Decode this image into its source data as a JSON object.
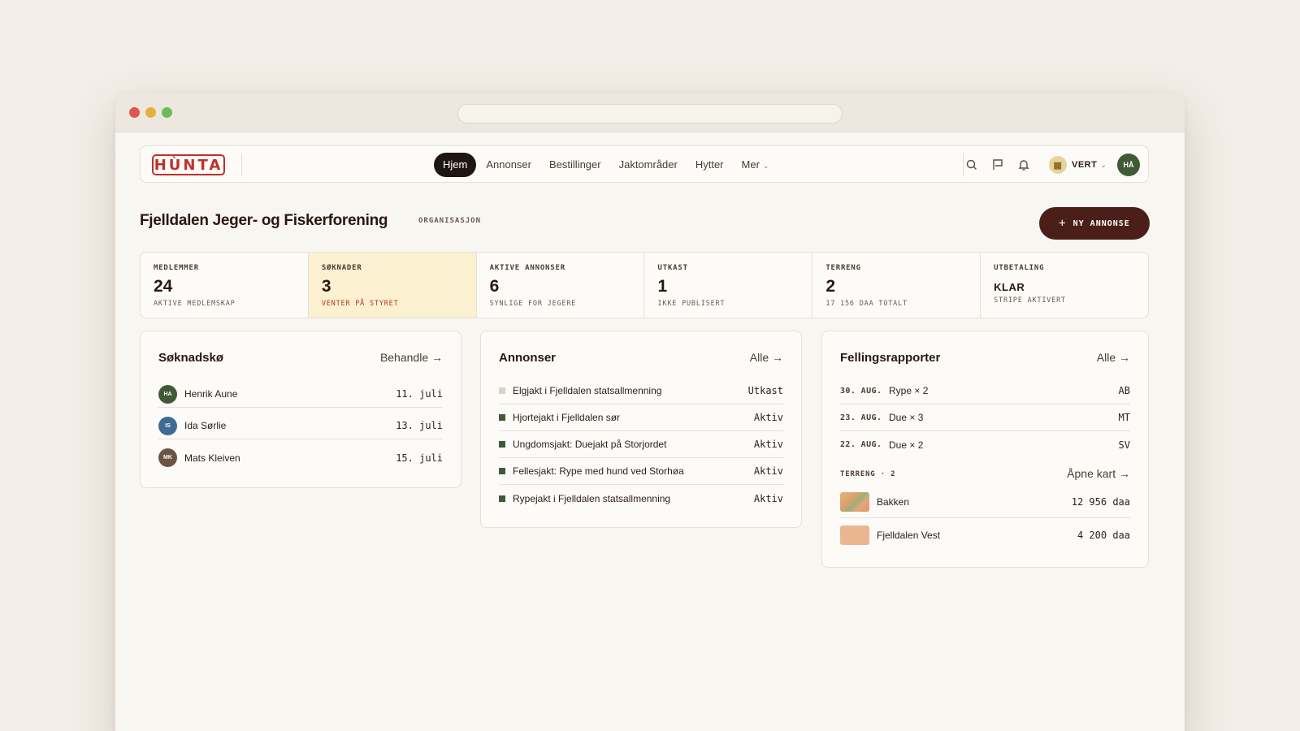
{
  "nav": {
    "logo": "HÙNTA",
    "items": [
      {
        "label": "Hjem",
        "active": true
      },
      {
        "label": "Annonser",
        "active": false
      },
      {
        "label": "Bestillinger",
        "active": false
      },
      {
        "label": "Jaktområder",
        "active": false
      },
      {
        "label": "Hytter",
        "active": false
      },
      {
        "label": "Mer",
        "active": false,
        "dropdown": true
      }
    ],
    "icons": [
      "search-icon",
      "flag-icon",
      "bell-icon"
    ],
    "host_label": "VERT",
    "avatar_initials": "HÅ"
  },
  "header": {
    "title": "Fjelldalen Jeger- og Fiskerforening",
    "tag": "ORGANISASJON",
    "new_button": "NY ANNONSE"
  },
  "stats": [
    {
      "label": "MEDLEMMER",
      "value": "24",
      "sub": "AKTIVE MEDLEMSKAP",
      "highlight": false
    },
    {
      "label": "SØKNADER",
      "value": "3",
      "sub": "VENTER PÅ STYRET",
      "highlight": true
    },
    {
      "label": "AKTIVE ANNONSER",
      "value": "6",
      "sub": "SYNLIGE FOR JEGERE",
      "highlight": false
    },
    {
      "label": "UTKAST",
      "value": "1",
      "sub": "IKKE PUBLISERT",
      "highlight": false
    },
    {
      "label": "TERRENG",
      "value": "2",
      "sub": "17 156 DAA TOTALT",
      "highlight": false
    },
    {
      "label": "UTBETALING",
      "value": "KLAR",
      "sub": "STRIPE AKTIVERT",
      "highlight": false
    }
  ],
  "queue": {
    "title": "Søknadskø",
    "link": "Behandle →",
    "rows": [
      {
        "initials": "HA",
        "name": "Henrik Aune",
        "date": "11. juli",
        "color": "#3f5a34"
      },
      {
        "initials": "IS",
        "name": "Ida Sørlie",
        "date": "13. juli",
        "color": "#3e6a93"
      },
      {
        "initials": "MK",
        "name": "Mats Kleiven",
        "date": "15. juli",
        "color": "#6b5444"
      }
    ]
  },
  "listings": {
    "title": "Annonser",
    "link": "Alle →",
    "rows": [
      {
        "name": "Elgjakt i Fjelldalen statsallmenning",
        "status": "Utkast",
        "draft": true
      },
      {
        "name": "Hjortejakt i Fjelldalen sør",
        "status": "Aktiv",
        "draft": false
      },
      {
        "name": "Ungdomsjakt: Duejakt på Storjordet",
        "status": "Aktiv",
        "draft": false
      },
      {
        "name": "Fellesjakt: Rype med hund ved Storhøa",
        "status": "Aktiv",
        "draft": false
      },
      {
        "name": "Rypejakt i Fjelldalen statsallmenning",
        "status": "Aktiv",
        "draft": false
      }
    ]
  },
  "reports": {
    "title": "Fellingsrapporter",
    "link": "Alle →",
    "rows": [
      {
        "date": "30. AUG.",
        "catch": "Rype × 2",
        "who": "AB"
      },
      {
        "date": "23. AUG.",
        "catch": "Due × 3",
        "who": "MT"
      },
      {
        "date": "22. AUG.",
        "catch": "Due × 2",
        "who": "SV"
      }
    ],
    "terrain_label": "TERRENG · 2",
    "terrain_link": "Åpne kart →",
    "terrain": [
      {
        "name": "Bakken",
        "area": "12 956 daa"
      },
      {
        "name": "Fjelldalen Vest",
        "area": "4 200 daa"
      }
    ]
  }
}
